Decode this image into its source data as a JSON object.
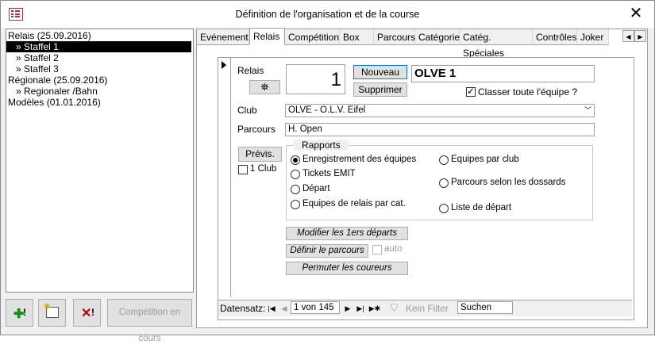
{
  "window": {
    "title": "Définition de l'organisation et de la course",
    "close_icon": "close-icon",
    "app_icon": "form-icon"
  },
  "tree": {
    "items": [
      {
        "label": "Relais (25.09.2016)",
        "indent": 0,
        "selected": false
      },
      {
        "label": "» Staffel 1",
        "indent": 1,
        "selected": true
      },
      {
        "label": "» Staffel 2",
        "indent": 1,
        "selected": false
      },
      {
        "label": "» Staffel 3",
        "indent": 1,
        "selected": false
      },
      {
        "label": "Régionale (25.09.2016)",
        "indent": 0,
        "selected": false
      },
      {
        "label": "» Regionaler /Bahn",
        "indent": 1,
        "selected": false
      },
      {
        "label": "Modèles (01.01.2016)",
        "indent": 0,
        "selected": false
      }
    ]
  },
  "bottom_buttons": {
    "add_icon": "add-green-plus-icon",
    "new_form_icon": "new-record-icon",
    "delete_icon": "delete-red-x-icon",
    "competition_label": "Compétition en cours"
  },
  "tabs": [
    "Evénement",
    "Relais",
    "Compétition",
    "Box",
    "Parcours",
    "Catégories",
    "Catég. Spéciales",
    "Contrôles",
    "Joker"
  ],
  "active_tab": "Relais",
  "form": {
    "relais_label": "Relais",
    "relais_number": "1",
    "nouveau_label": "Nouveau",
    "supprimer_label": "Supprimer",
    "team_name": "OLVE 1",
    "classer_label": "Classer toute l'équipe ?",
    "classer_checked": true,
    "club_label": "Club",
    "club_value": "OLVE - O.L.V. Eifel",
    "parcours_label": "Parcours",
    "parcours_value": "H. Open",
    "previs_label": "Prévis.",
    "one_club_label": "1 Club",
    "rapports_label": "Rapports",
    "radios_left": [
      "Enregistrement des équipes",
      "Tickets EMIT",
      "Départ",
      "Equipes de relais par cat."
    ],
    "radios_right": [
      "Equipes par club",
      "Parcours selon les dossards",
      "Liste de départ"
    ],
    "modifier_label": "Modifier les 1ers départs",
    "definir_label": "Définir le parcours",
    "auto_label": "auto",
    "permuter_label": "Permuter les coureurs"
  },
  "nav": {
    "datensatz_label": "Datensatz:",
    "record": "1 von 145",
    "filter_label": "Kein Filter",
    "search_label": "Suchen"
  }
}
